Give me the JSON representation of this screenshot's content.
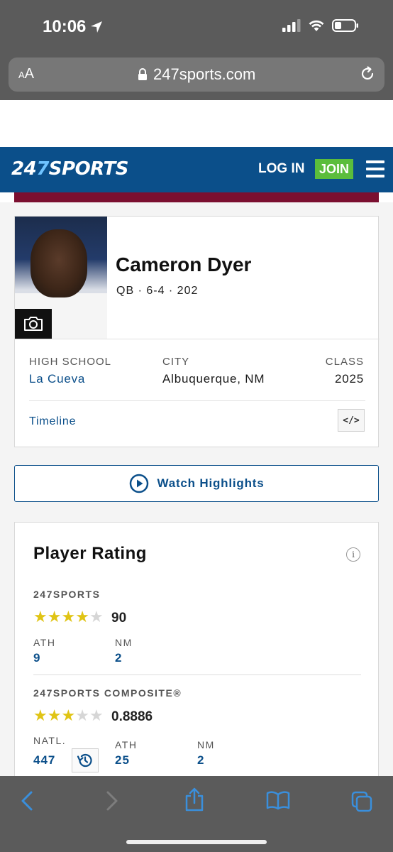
{
  "status_bar": {
    "time": "10:06"
  },
  "browser": {
    "aa_label_small": "A",
    "aa_label": "A",
    "url": "247sports.com"
  },
  "site_header": {
    "logo_prefix": "24",
    "logo_seven": "7",
    "logo_suffix": "SPORTS",
    "login": "LOG IN",
    "join": "JOIN"
  },
  "profile": {
    "name": "Cameron Dyer",
    "meta": "QB · 6-4 · 202",
    "high_school_label": "HIGH SCHOOL",
    "high_school": "La Cueva",
    "city_label": "CITY",
    "city": "Albuquerque, NM",
    "class_label": "CLASS",
    "class_year": "2025",
    "timeline": "Timeline",
    "embed_label": "</>"
  },
  "watch": {
    "label": "Watch Highlights"
  },
  "rating": {
    "title": "Player Rating",
    "info": "i",
    "s247": {
      "label": "247SPORTS",
      "stars": 4,
      "score": "90",
      "pos_label": "ATH",
      "pos_rank": "9",
      "state_label": "NM",
      "state_rank": "2"
    },
    "composite": {
      "label": "247SPORTS COMPOSITE®",
      "stars": 3,
      "score": "0.8886",
      "natl_label": "NATL.",
      "natl_rank": "447",
      "pos_label": "ATH",
      "pos_rank": "25",
      "state_label": "NM",
      "state_rank": "2"
    }
  },
  "colors": {
    "brand_blue": "#0b4f8a",
    "join_green": "#5bbd3c",
    "maroon": "#7b0f30",
    "star_gold": "#e0c414",
    "toolbar_icon_blue": "#3a8fdc"
  },
  "toolbar": {
    "icons": [
      "back-icon",
      "forward-icon",
      "share-icon",
      "bookmarks-icon",
      "tabs-icon"
    ]
  }
}
